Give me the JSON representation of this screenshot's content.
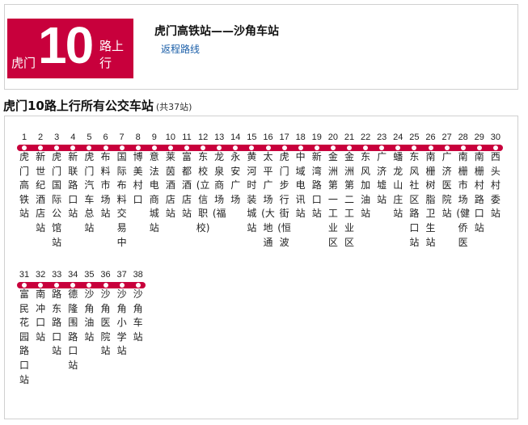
{
  "header": {
    "route_prefix": "虎门",
    "route_number": "10",
    "route_suffix": "路上行",
    "route_title": "虎门高铁站——沙角车站",
    "return_link": "返程路线"
  },
  "section": {
    "title": "虎门10路上行所有公交车站",
    "count": "(共37站)"
  },
  "colors": {
    "accent": "#c8003c",
    "link": "#1a5ea8"
  },
  "stops": [
    {
      "num": "1",
      "name": "虎门高铁站"
    },
    {
      "num": "2",
      "name": "新世纪酒店站"
    },
    {
      "num": "3",
      "name": "虎门国际公馆站"
    },
    {
      "num": "4",
      "name": "新联路口站"
    },
    {
      "num": "5",
      "name": "虎门汽车总站"
    },
    {
      "num": "6",
      "name": "布料市场站"
    },
    {
      "num": "7",
      "name": "国际布料交易中"
    },
    {
      "num": "8",
      "name": "博美村口"
    },
    {
      "num": "9",
      "name": "意法电商城站"
    },
    {
      "num": "10",
      "name": "莱茵酒店站"
    },
    {
      "num": "11",
      "name": "富都酒店站"
    },
    {
      "num": "12",
      "name": "东校(立信职校)"
    },
    {
      "num": "13",
      "name": "龙泉商场(福"
    },
    {
      "num": "14",
      "name": "永安广场"
    },
    {
      "num": "15",
      "name": "黄河时装城站"
    },
    {
      "num": "16",
      "name": "太平广场(大地通"
    },
    {
      "num": "17",
      "name": "虎门步行街(恒波"
    },
    {
      "num": "18",
      "name": "中域电讯站"
    },
    {
      "num": "19",
      "name": "新湾路口站"
    },
    {
      "num": "20",
      "name": "金洲第一工业区"
    },
    {
      "num": "21",
      "name": "金洲第二工业区"
    },
    {
      "num": "22",
      "name": "东风加油站"
    },
    {
      "num": "23",
      "name": "广济墟站"
    },
    {
      "num": "24",
      "name": "蟠龙山庄站"
    },
    {
      "num": "25",
      "name": "东风社区路口站"
    },
    {
      "num": "26",
      "name": "南栅树脂卫生站"
    },
    {
      "num": "27",
      "name": "广济医院站"
    },
    {
      "num": "28",
      "name": "南栅市场(健侨医"
    },
    {
      "num": "29",
      "name": "南栅村路口站"
    },
    {
      "num": "30",
      "name": "西头村委站"
    },
    {
      "num": "31",
      "name": "富民花园路口站"
    },
    {
      "num": "32",
      "name": "南冲口站"
    },
    {
      "num": "33",
      "name": "路东路口站"
    },
    {
      "num": "34",
      "name": "德隆围路口站"
    },
    {
      "num": "35",
      "name": "沙角油站"
    },
    {
      "num": "36",
      "name": "沙角医院站"
    },
    {
      "num": "37",
      "name": "沙角小学站"
    },
    {
      "num": "38",
      "name": "沙角车站"
    }
  ]
}
